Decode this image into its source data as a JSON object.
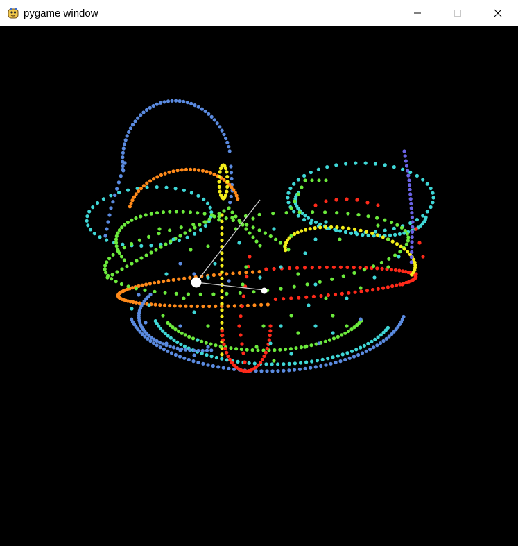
{
  "window": {
    "title": "pygame window",
    "icon": "pygame-snake-icon",
    "controls": {
      "minimize_icon": "minimize-icon",
      "maximize_icon": "maximize-icon",
      "close_icon": "close-icon"
    }
  },
  "scene": {
    "background": "#000000",
    "palette": {
      "blue": "#5b8be0",
      "cyan": "#3fd7d7",
      "green": "#6cea3c",
      "yellow": "#f4ee1a",
      "orange": "#ff8a1a",
      "red": "#ff2a1a",
      "white": "#ffffff",
      "purple": "#6b63e6"
    }
  }
}
